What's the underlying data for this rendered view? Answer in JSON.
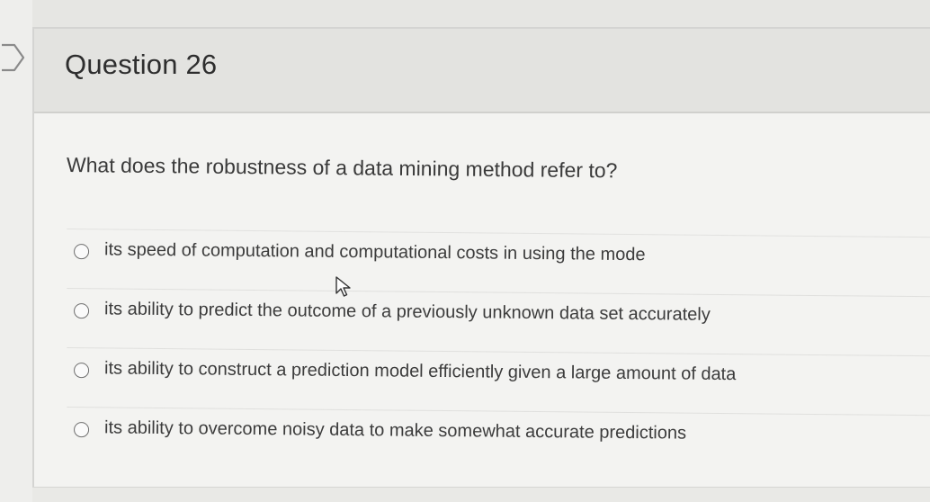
{
  "question": {
    "title": "Question 26",
    "prompt": "What does the robustness of a data mining method refer to?",
    "options": [
      {
        "label": "its speed of computation and computational costs in using the mode",
        "selected": false
      },
      {
        "label": "its ability to predict the outcome of a previously unknown data set accurately",
        "selected": false
      },
      {
        "label": "its ability to construct a prediction model efficiently given a large amount of data",
        "selected": false
      },
      {
        "label": "its ability to overcome noisy data to make somewhat accurate predictions",
        "selected": false
      }
    ]
  },
  "icons": {
    "collapse": "chevron-right-icon",
    "cursor": "mouse-pointer-icon"
  },
  "colors": {
    "background": "#e6e6e3",
    "card": "#f3f3f1",
    "header": "#e3e3e0",
    "text": "#3a3a3a",
    "radio_border": "#6e6e6e"
  }
}
